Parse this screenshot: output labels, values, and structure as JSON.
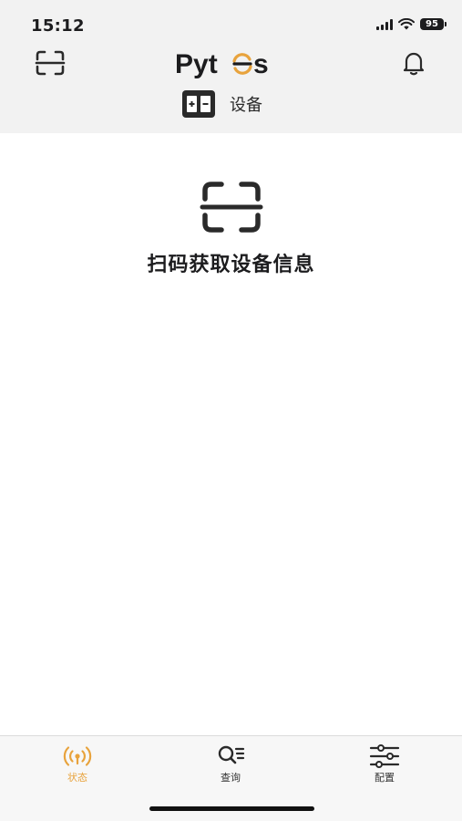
{
  "status_bar": {
    "time": "15:12",
    "battery": "95"
  },
  "header": {
    "brand": "Pytes",
    "device_tab_label": "设备"
  },
  "main": {
    "scan_prompt": "扫码获取设备信息"
  },
  "tab_bar": {
    "items": [
      {
        "label": "状态",
        "icon": "radio-signal-icon",
        "active": true
      },
      {
        "label": "查询",
        "icon": "search-list-icon",
        "active": false
      },
      {
        "label": "配置",
        "icon": "sliders-icon",
        "active": false
      }
    ]
  },
  "colors": {
    "accent": "#e8a33d",
    "header_bg": "#f2f2f2",
    "text": "#1c1c1e"
  }
}
